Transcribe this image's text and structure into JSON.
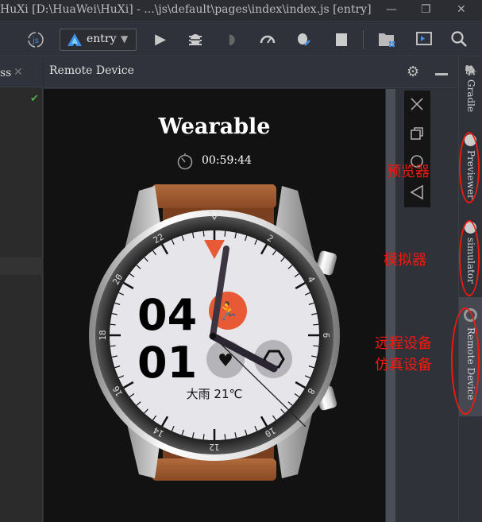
{
  "window": {
    "title": "HuXi [D:\\HuaWei\\HuXi] - ...\\js\\default\\pages\\index\\index.js [entry]",
    "minimize": "—",
    "restore": "❐",
    "close": "✕"
  },
  "toolbar": {
    "module": "entry",
    "accent": "#3d8fe6"
  },
  "left_panel": {
    "tab_label": "ss",
    "close": "✕"
  },
  "panel": {
    "title": "Remote Device"
  },
  "device": {
    "app_title": "Wearable",
    "timer": "00:59:44",
    "watch": {
      "top_digits": "04",
      "bottom_digits": "01",
      "weather": "大雨 21℃",
      "bezel_labels": [
        "2",
        "4",
        "6",
        "8",
        "10",
        "12",
        "14",
        "16",
        "18",
        "20",
        "22"
      ],
      "accent": "#e85a35"
    }
  },
  "right_strip": {
    "items": [
      {
        "label": "Gradle"
      },
      {
        "label": "Previewer"
      },
      {
        "label": "simulator"
      },
      {
        "label": "Remote Device"
      }
    ]
  },
  "annotations": {
    "previewer": "预览器",
    "simulator": "模拟器",
    "remote_line1": "远程设备",
    "remote_line2": "仿真设备",
    "color": "#f01a10"
  }
}
